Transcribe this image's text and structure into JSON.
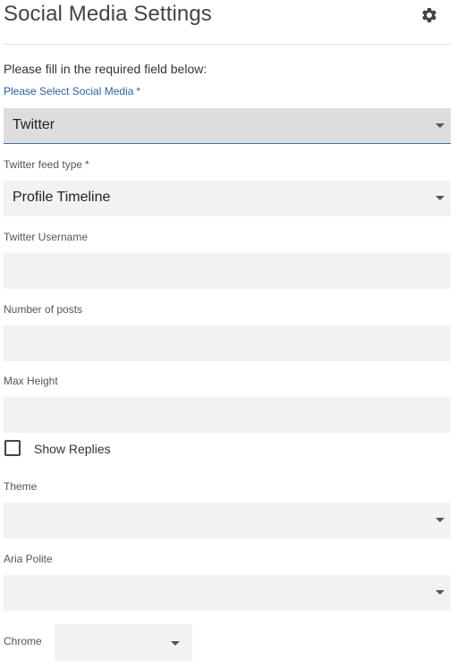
{
  "header": {
    "title": "Social Media Settings",
    "settings_icon": "gear-icon"
  },
  "form": {
    "instructions": "Please fill in the required field below:",
    "social_media": {
      "label": "Please Select Social Media",
      "required_mark": "*",
      "value": "Twitter"
    },
    "feed_type": {
      "label": "Twitter feed type",
      "required_mark": "*",
      "value": "Profile Timeline"
    },
    "username": {
      "label": "Twitter Username",
      "value": ""
    },
    "num_posts": {
      "label": "Number of posts",
      "value": ""
    },
    "max_height": {
      "label": "Max Height",
      "value": ""
    },
    "show_replies": {
      "label": "Show Replies",
      "checked": false
    },
    "theme": {
      "label": "Theme",
      "value": ""
    },
    "aria_polite": {
      "label": "Aria Polite",
      "value": ""
    },
    "chrome": {
      "label": "Chrome",
      "value": ""
    }
  },
  "colors": {
    "accent": "#2b5fa6",
    "field_bg": "#f2f2f2",
    "active_field_bg": "#dddddd"
  }
}
